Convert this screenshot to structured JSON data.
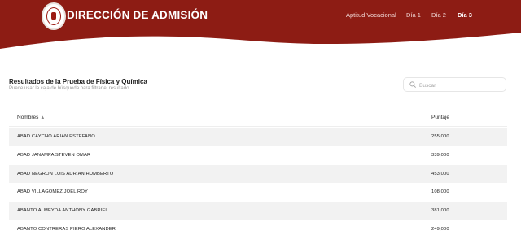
{
  "header": {
    "brand": "DIRECCIÓN DE ADMISIÓN",
    "colors": {
      "primary": "#8d1c14",
      "primary_dark": "#7f1610"
    },
    "nav": [
      {
        "label": "Aptitud Vocacional",
        "active": false
      },
      {
        "label": "Día 1",
        "active": false
      },
      {
        "label": "Día 2",
        "active": false
      },
      {
        "label": "Día 3",
        "active": true
      }
    ]
  },
  "panel": {
    "title": "Resultados de la Prueba de Física y Química",
    "subtitle": "Puede usar la caja de búsqueda para filtrar el resultado"
  },
  "search": {
    "placeholder": "Buscar",
    "value": "",
    "icon": "search-icon"
  },
  "table": {
    "columns": [
      {
        "label": "Nombres",
        "sort": "ascending"
      },
      {
        "label": "Puntaje"
      }
    ],
    "rows": [
      {
        "name": "ABAD CAYCHO ARIAN ESTEFANO",
        "score": "255,000"
      },
      {
        "name": "ABAD JANAMPA STEVEN OMAR",
        "score": "339,000"
      },
      {
        "name": "ABAD NEGRON LUIS ADRIAN HUMBERTO",
        "score": "453,000"
      },
      {
        "name": "ABAD VILLAGOMEZ JOEL ROY",
        "score": "108,000"
      },
      {
        "name": "ABANTO ALMEYDA ANTHONY GABRIEL",
        "score": "381,000"
      },
      {
        "name": "ABANTO CONTRERAS PIERO ALEXANDER",
        "score": "249,000"
      }
    ]
  }
}
